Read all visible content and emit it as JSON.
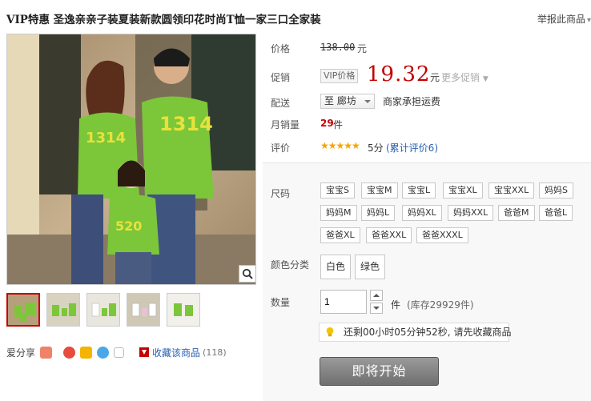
{
  "product": {
    "title": "VIP特惠 圣逸亲亲子装夏装新款圆领印花时尚T恤一家三口全家装",
    "report_label": "举报此商品"
  },
  "gallery": {
    "thumbnail_count": 5,
    "share_label": "爱分享",
    "favorite_label": "收藏该商品",
    "favorite_count": "(118)",
    "shirt_print_1": "1314",
    "shirt_print_2": "520"
  },
  "price": {
    "label": "价格",
    "original": "138.00",
    "unit": "元"
  },
  "promo": {
    "label": "促销",
    "tag": "VIP价格",
    "value": "19.32",
    "unit": "元",
    "more": "更多促销"
  },
  "shipping": {
    "label": "配送",
    "destination": "至 廊坊",
    "note": "商家承担运费"
  },
  "monthly_sales": {
    "label": "月销量",
    "count": "29",
    "unit": "件"
  },
  "rating": {
    "label": "评价",
    "stars": "★★★★★",
    "score": "5分",
    "reviews": "(累计评价6)"
  },
  "sizes": {
    "label": "尺码",
    "options": [
      "宝宝S",
      "宝宝M",
      "宝宝L",
      "宝宝XL",
      "宝宝XXL",
      "妈妈S",
      "妈妈M",
      "妈妈L",
      "妈妈XL",
      "妈妈XXL",
      "爸爸M",
      "爸爸L",
      "爸爸XL",
      "爸爸XXL",
      "爸爸XXXL"
    ]
  },
  "colors": {
    "label": "颜色分类",
    "options": [
      "白色",
      "绿色"
    ]
  },
  "quantity": {
    "label": "数量",
    "value": "1",
    "unit": "件",
    "stock": "(库存29929件)"
  },
  "notice": "还剩00小时05分钟52秒, 请先收藏商品",
  "buy_button": "即将开始",
  "theme": {
    "price_red": "#c40000",
    "link_blue": "#2a60b0",
    "shirt_green": "#7cc63a",
    "star_orange": "#f5a500"
  }
}
